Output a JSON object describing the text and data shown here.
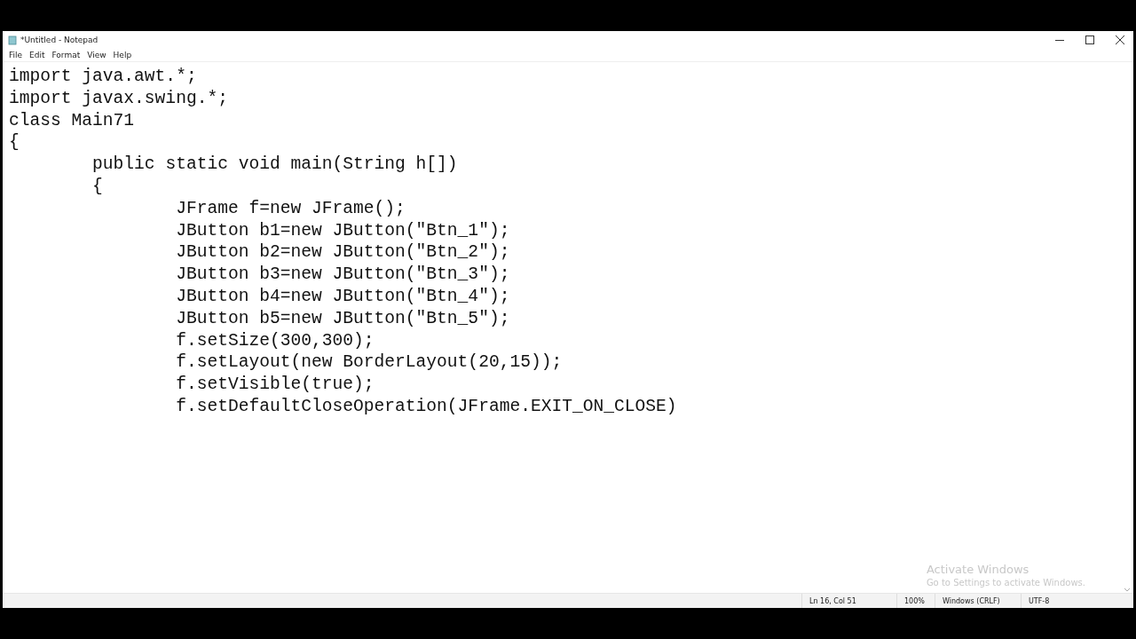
{
  "window": {
    "title": "*Untitled - Notepad"
  },
  "menu": [
    "File",
    "Edit",
    "Format",
    "View",
    "Help"
  ],
  "editor": {
    "lines": [
      "import java.awt.*;",
      "import javax.swing.*;",
      "class Main71",
      "{",
      "\tpublic static void main(String h[])",
      "\t{",
      "\t\tJFrame f=new JFrame();",
      "\t\tJButton b1=new JButton(\"Btn_1\");",
      "\t\tJButton b2=new JButton(\"Btn_2\");",
      "\t\tJButton b3=new JButton(\"Btn_3\");",
      "\t\tJButton b4=new JButton(\"Btn_4\");",
      "\t\tJButton b5=new JButton(\"Btn_5\");",
      "\t\tf.setSize(300,300);",
      "\t\tf.setLayout(new BorderLayout(20,15));",
      "\t\tf.setVisible(true);",
      "\t\tf.setDefaultCloseOperation(JFrame.EXIT_ON_CLOSE)"
    ]
  },
  "activation_notice": {
    "title": "Activate Windows",
    "message": "Go to Settings to activate Windows."
  },
  "status_bar": [
    "Ln 16, Col 51",
    "100%",
    "Windows (CRLF)",
    "UTF-8"
  ]
}
